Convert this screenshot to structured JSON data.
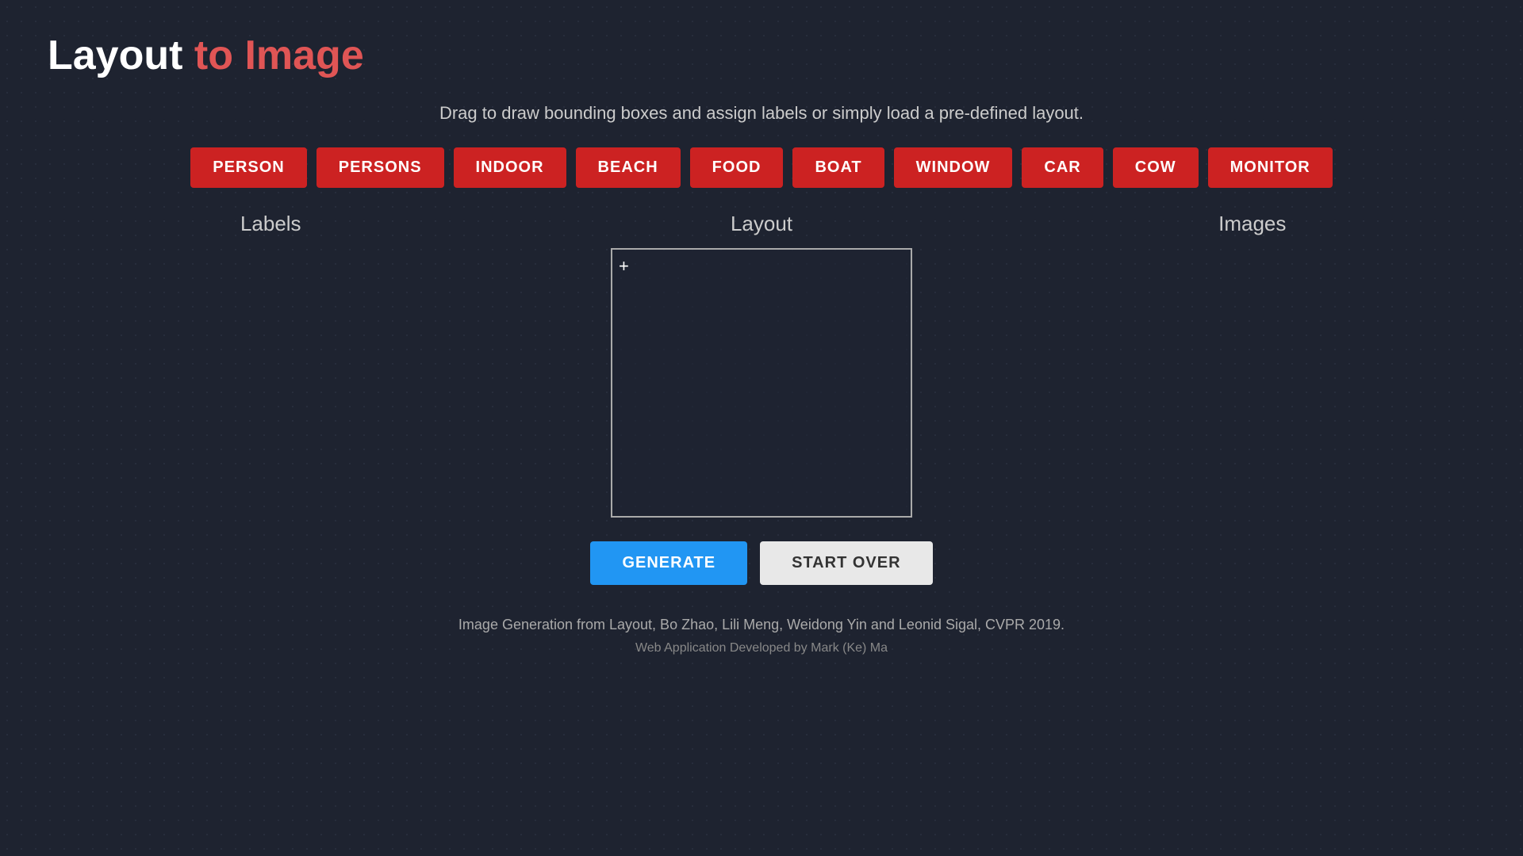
{
  "title": {
    "part1": "Layout",
    "part2": "to",
    "part3": "Image"
  },
  "subtitle": "Drag to draw bounding boxes and assign labels or simply load a pre-defined layout.",
  "label_buttons": [
    {
      "id": "person",
      "label": "PERSON"
    },
    {
      "id": "persons",
      "label": "PERSONS"
    },
    {
      "id": "indoor",
      "label": "INDOOR"
    },
    {
      "id": "beach",
      "label": "BEACH"
    },
    {
      "id": "food",
      "label": "FOOD"
    },
    {
      "id": "boat",
      "label": "BOAT"
    },
    {
      "id": "window",
      "label": "WINDOW"
    },
    {
      "id": "car",
      "label": "CAR"
    },
    {
      "id": "cow",
      "label": "COW"
    },
    {
      "id": "monitor",
      "label": "MONITOR"
    }
  ],
  "sections": {
    "labels": "Labels",
    "layout": "Layout",
    "images": "Images"
  },
  "buttons": {
    "generate": "GENERATE",
    "start_over": "START OVER"
  },
  "footer": {
    "line1": "Image Generation from Layout, Bo Zhao, Lili Meng, Weidong Yin and Leonid Sigal, CVPR 2019.",
    "line2": "Web Application Developed by Mark (Ke) Ma"
  }
}
